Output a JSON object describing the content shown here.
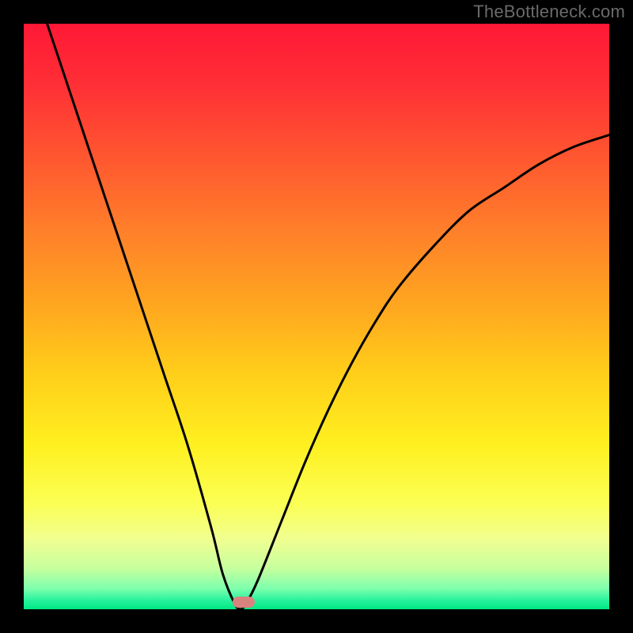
{
  "watermark": "TheBottleneck.com",
  "chart_data": {
    "type": "line",
    "title": "",
    "xlabel": "",
    "ylabel": "",
    "xlim": [
      0,
      100
    ],
    "ylim": [
      0,
      100
    ],
    "grid": false,
    "legend": false,
    "series": [
      {
        "name": "bottleneck-curve",
        "x": [
          4,
          8,
          12,
          16,
          20,
          24,
          28,
          32,
          34,
          36,
          37,
          38,
          40,
          44,
          48,
          52,
          56,
          60,
          64,
          70,
          76,
          82,
          88,
          94,
          100
        ],
        "values": [
          100,
          88,
          76,
          64,
          52,
          40,
          28,
          14,
          6,
          1,
          0,
          1,
          5,
          15,
          25,
          34,
          42,
          49,
          55,
          62,
          68,
          72,
          76,
          79,
          81
        ]
      }
    ],
    "curve_min_x": 37,
    "marker": {
      "x": 37.5,
      "y": 1.2,
      "color": "#d9837e"
    },
    "gradient_stops": [
      {
        "pos": 0.0,
        "color": "#ff1836"
      },
      {
        "pos": 0.1,
        "color": "#ff2e36"
      },
      {
        "pos": 0.22,
        "color": "#ff5430"
      },
      {
        "pos": 0.35,
        "color": "#ff7e2a"
      },
      {
        "pos": 0.48,
        "color": "#ffa61f"
      },
      {
        "pos": 0.6,
        "color": "#ffcf1a"
      },
      {
        "pos": 0.72,
        "color": "#fff020"
      },
      {
        "pos": 0.82,
        "color": "#fbff55"
      },
      {
        "pos": 0.88,
        "color": "#f1ff90"
      },
      {
        "pos": 0.93,
        "color": "#c7ff9e"
      },
      {
        "pos": 0.965,
        "color": "#7cffad"
      },
      {
        "pos": 0.985,
        "color": "#26f29c"
      },
      {
        "pos": 1.0,
        "color": "#00e884"
      }
    ],
    "curve_color": "#000000",
    "curve_width": 3
  }
}
